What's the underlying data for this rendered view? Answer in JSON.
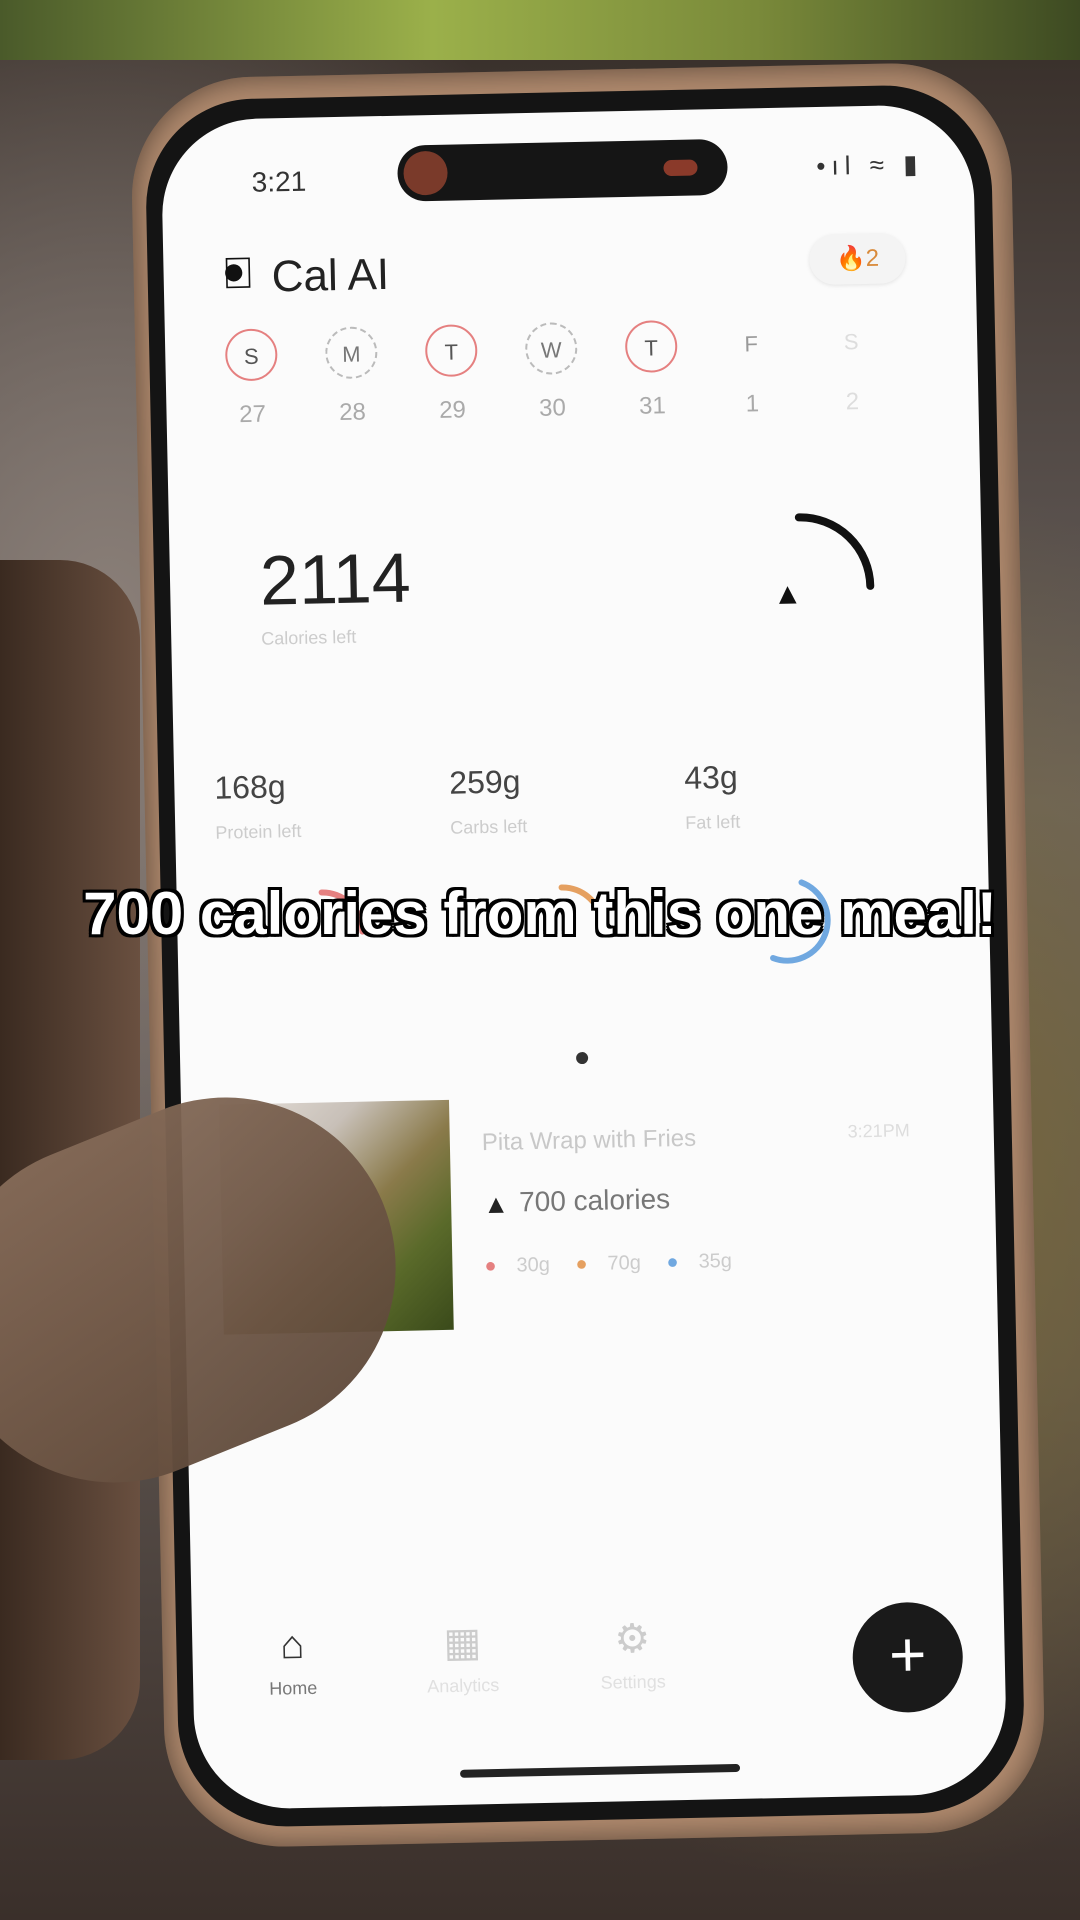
{
  "status": {
    "time": "3:21",
    "icons": "•ıl ≈ ▮"
  },
  "app": {
    "title": "Cal AI",
    "streak": "🔥2"
  },
  "days": [
    {
      "letter": "S",
      "num": "27"
    },
    {
      "letter": "M",
      "num": "28"
    },
    {
      "letter": "T",
      "num": "29"
    },
    {
      "letter": "W",
      "num": "30"
    },
    {
      "letter": "T",
      "num": "31"
    },
    {
      "letter": "F",
      "num": "1"
    },
    {
      "letter": "S",
      "num": "2"
    }
  ],
  "calories": {
    "value": "2114",
    "label": "Calories left"
  },
  "macros": [
    {
      "value": "168g",
      "label": "Protein left"
    },
    {
      "value": "259g",
      "label": "Carbs left"
    },
    {
      "value": "43g",
      "label": "Fat left"
    }
  ],
  "food": {
    "name": "Pita Wrap with Fries",
    "time": "3:21PM",
    "calories": "700 calories",
    "protein": "30g",
    "carbs": "70g",
    "fat": "35g"
  },
  "tabs": [
    {
      "label": "Home"
    },
    {
      "label": "Analytics"
    },
    {
      "label": "Settings"
    }
  ],
  "add_button": "+",
  "caption": "700 calories from this one meal!",
  "colors": {
    "accent": "#1a1a1a",
    "protein": "#e58080",
    "carbs": "#e5a060",
    "fat": "#70a8e0"
  }
}
